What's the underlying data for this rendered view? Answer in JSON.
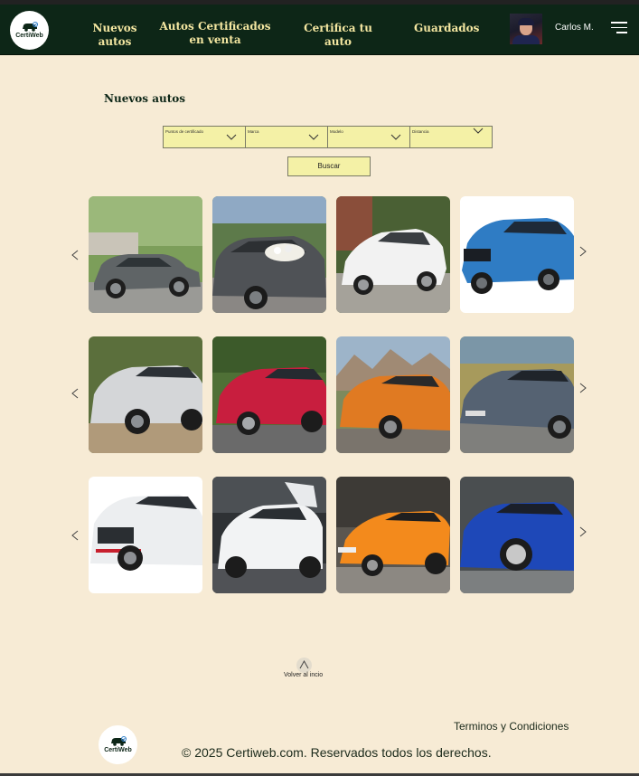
{
  "brand": {
    "name": "CertiWeb"
  },
  "nav": {
    "items": [
      "Nuevos autos",
      "Autos Certificados en venta",
      "Certifica tu auto",
      "Guardados"
    ]
  },
  "user": {
    "name": "Carlos M."
  },
  "main": {
    "title": "Nuevos autos",
    "filters": [
      "Puntos de certificado",
      "Marca",
      "Modelo",
      "Distancia"
    ],
    "search_label": "Buscar"
  },
  "gallery": {
    "rows": [
      {
        "cars": [
          "silver-sedan",
          "grey-hatchback-wedding",
          "white-coupe",
          "blue-suv"
        ]
      },
      {
        "cars": [
          "silver-crossover",
          "red-hatchback",
          "orange-muscle-car",
          "blue-grey-coupe"
        ]
      },
      {
        "cars": [
          "white-suv",
          "white-electric-suv",
          "orange-supercar",
          "blue-sports-car"
        ]
      }
    ]
  },
  "footer": {
    "back_label": "Volver al incio",
    "terms": "Terminos y Condiciones",
    "copyright": "© 2025 Certiweb.com. Reservados todos los derechos."
  },
  "colors": {
    "header_bg": "#0d2617",
    "nav_text": "#f4e7a1",
    "page_bg": "#f7ebd5",
    "filter_bg": "#f4f1a6"
  }
}
